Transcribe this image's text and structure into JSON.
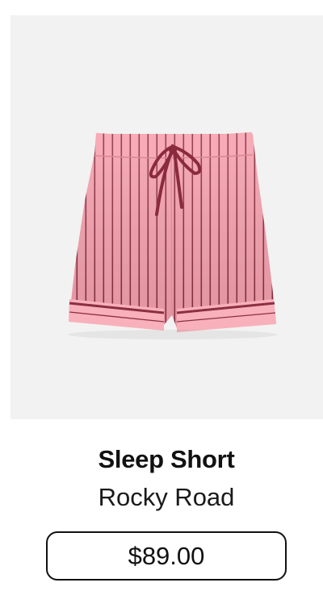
{
  "product": {
    "image_icon": "pink-striped-sleep-shorts-photo",
    "name": "Sleep Short",
    "color": "Rocky Road",
    "price": "$89.00"
  },
  "colors": {
    "image_background": "#f2f2f2",
    "fabric": "#f6a2ae",
    "stripe": "#8c2f43",
    "drawstring": "#8a2a3f"
  }
}
